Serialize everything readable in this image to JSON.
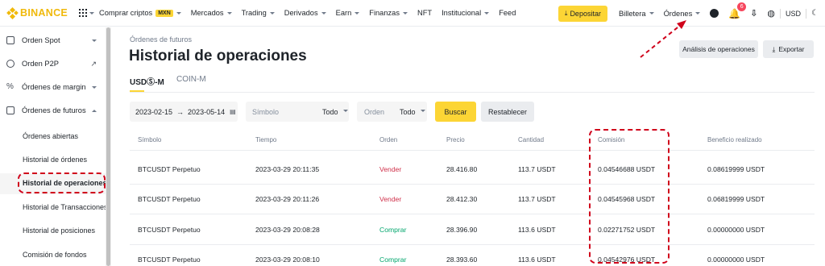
{
  "nav": {
    "logo": "BINANCE",
    "items": [
      {
        "label": "Comprar criptos",
        "badge": "MXN",
        "caret": true
      },
      {
        "label": "Mercados",
        "caret": true
      },
      {
        "label": "Trading",
        "caret": true
      },
      {
        "label": "Derivados",
        "caret": true
      },
      {
        "label": "Earn",
        "caret": true
      },
      {
        "label": "Finanzas",
        "caret": true
      },
      {
        "label": "NFT",
        "caret": false
      },
      {
        "label": "Institucional",
        "caret": true
      },
      {
        "label": "Feed",
        "caret": false
      }
    ],
    "deposit": "Depositar",
    "wallet": "Billetera",
    "orders": "Órdenes",
    "notifications": "6",
    "currency": "USD"
  },
  "sidebar": {
    "spot": "Orden Spot",
    "p2p": "Orden P2P",
    "margin": "Órdenes de margin",
    "futures": "Órdenes de futuros",
    "sub": [
      "Órdenes abiertas",
      "Historial de órdenes",
      "Historial de operaciones",
      "Historial de Transacciones",
      "Historial de posiciones",
      "Comisión de fondos"
    ]
  },
  "page": {
    "breadcrumb": "Órdenes de futuros",
    "title": "Historial de operaciones",
    "tab_usdm": "USDⓈ-M",
    "tab_coinm": "COIN-M",
    "btn_analysis": "Análisis de operaciones",
    "btn_export": "Exportar"
  },
  "filters": {
    "date_from": "2023-02-15",
    "date_to": "2023-05-14",
    "symbol_placeholder": "Símbolo",
    "symbol_value": "Todo",
    "order_placeholder": "Orden",
    "order_value": "Todo",
    "search": "Buscar",
    "reset": "Restablecer"
  },
  "table": {
    "headers": {
      "symbol": "Símbolo",
      "time": "Tiempo",
      "side": "Orden",
      "price": "Precio",
      "qty": "Cantidad",
      "fee": "Comisión",
      "pnl": "Beneficio realizado"
    },
    "rows": [
      {
        "symbol": "BTCUSDT Perpetuo",
        "time": "2023-03-29 20:11:35",
        "side": "Vender",
        "price": "28.416.80",
        "qty": "113.7 USDT",
        "fee": "0.04546688 USDT",
        "pnl": "0.08619999 USDT"
      },
      {
        "symbol": "BTCUSDT Perpetuo",
        "time": "2023-03-29 20:11:26",
        "side": "Vender",
        "price": "28.412.30",
        "qty": "113.7 USDT",
        "fee": "0.04545968 USDT",
        "pnl": "0.06819999 USDT"
      },
      {
        "symbol": "BTCUSDT Perpetuo",
        "time": "2023-03-29 20:08:28",
        "side": "Comprar",
        "price": "28.396.90",
        "qty": "113.6 USDT",
        "fee": "0.02271752 USDT",
        "pnl": "0.00000000 USDT"
      },
      {
        "symbol": "BTCUSDT Perpetuo",
        "time": "2023-03-29 20:08:10",
        "side": "Comprar",
        "price": "28.393.60",
        "qty": "113.6 USDT",
        "fee": "0.04542976 USDT",
        "pnl": "0.00000000 USDT"
      }
    ]
  },
  "colors": {
    "brand": "#f0b90b",
    "accent": "#fcd535",
    "sell": "#cf304a",
    "buy": "#03a66d",
    "annotation": "#d0021b"
  }
}
